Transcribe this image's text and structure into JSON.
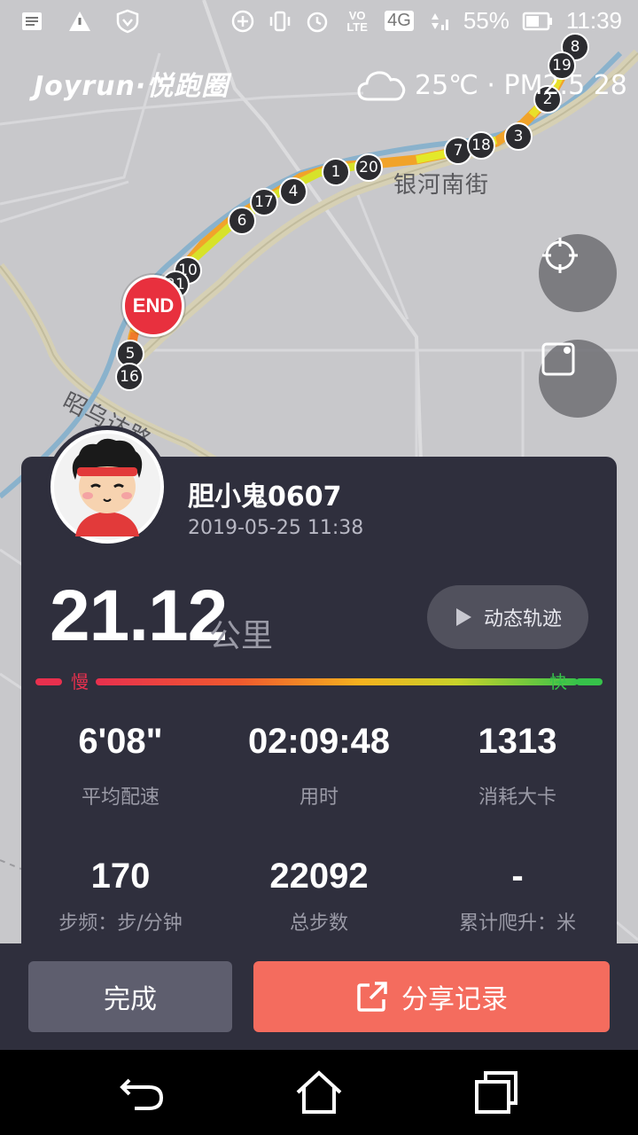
{
  "status_bar": {
    "battery": "55%",
    "time": "11:39",
    "network": "4G",
    "volte": "VO LTE"
  },
  "brand": "Joyrun·悦跑圈",
  "weather": {
    "icon": "cloud-icon",
    "text": "25℃ · PM2.5 28"
  },
  "map": {
    "street_labels": [
      "银河南街",
      "昭乌达路"
    ],
    "end_label": "END",
    "km_markers": [
      "1",
      "2",
      "3",
      "4",
      "5",
      "6",
      "7",
      "8",
      "10",
      "16",
      "17",
      "18",
      "19",
      "20",
      "21"
    ]
  },
  "user": {
    "name": "胆小鬼0607",
    "datetime": "2019-05-25 11:38"
  },
  "run": {
    "distance": "21.12",
    "distance_unit": "公里",
    "replay_label": "动态轨迹"
  },
  "speed_legend": {
    "slow": "慢",
    "fast": "快"
  },
  "stats": [
    {
      "value": "6'08\"",
      "label": "平均配速"
    },
    {
      "value": "02:09:48",
      "label": "用时"
    },
    {
      "value": "1313",
      "label": "消耗大卡"
    },
    {
      "value": "170",
      "label": "步频：步/分钟"
    },
    {
      "value": "22092",
      "label": "总步数"
    },
    {
      "value": "-",
      "label": "累计爬升：米"
    }
  ],
  "actions": {
    "done": "完成",
    "share": "分享记录"
  },
  "colors": {
    "card_bg": "#2f2f3d",
    "share_button": "#f46c5e",
    "done_button": "#5e5e6e",
    "end_marker": "#e8303e",
    "slow": "#e8304e",
    "fast": "#36c24a"
  }
}
